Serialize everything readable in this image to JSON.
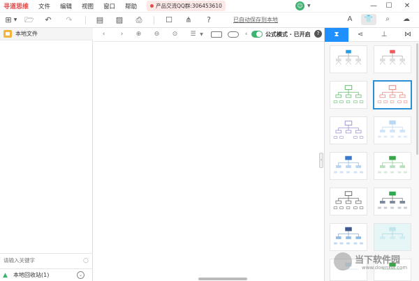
{
  "titlebar": {
    "app_name": "寻道思维",
    "menus": [
      "文件",
      "编辑",
      "视图",
      "窗口",
      "帮助"
    ],
    "qq_group": "产品交流QQ群:306453610",
    "user_initial": "☺"
  },
  "toolbar": {
    "autosave_text": "已自动保存到本地"
  },
  "canvas_toolbar": {
    "formula_mode": "公式模式 · 已开启"
  },
  "left_panel": {
    "local_files_label": "本地文件",
    "search_placeholder": "请输入关键字",
    "recycle_label": "本地回收站(1)"
  },
  "right_panel": {
    "active_tab_index": 0,
    "selected_style_index": 3
  },
  "colors": {
    "accent": "#1e90ff",
    "toggle_on": "#3cb371",
    "brand": "#e14d4d"
  },
  "watermark": {
    "title": "当下软件园",
    "url": "www.downxia.com"
  }
}
